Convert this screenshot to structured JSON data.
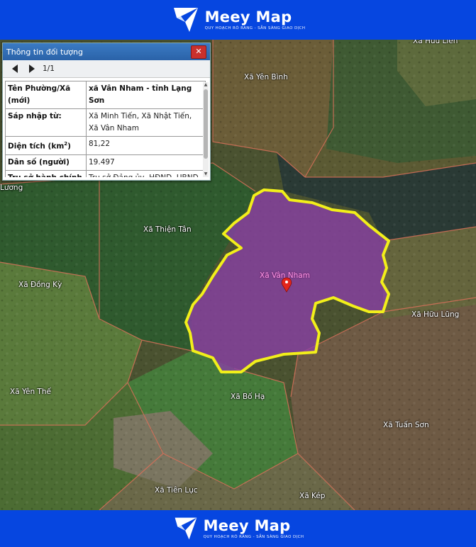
{
  "brand": {
    "name": "Meey Map",
    "tagline": "QUY HOẠCH RÕ RÀNG - SẴN SÀNG GIAO DỊCH"
  },
  "panel": {
    "title": "Thông tin đối tượng",
    "close": "✕",
    "page": "1/1",
    "rows": [
      {
        "key": "Tên Phường/Xã (mới)",
        "value": "xã Vân Nham - tỉnh Lạng Sơn"
      },
      {
        "key": "Sáp nhập từ:",
        "value": "Xã Minh Tiến, Xã Nhật Tiến, Xã Vân Nham"
      },
      {
        "key_main": "Diện tích (km",
        "key_sup": "2",
        "key_end": ")",
        "value": "81,22"
      },
      {
        "key": "Dân số (người)",
        "value": "19.497"
      },
      {
        "key": "Trụ sở hành chính (mới)",
        "value": "Trụ sở Đảng ủy, HĐND, UBND xã Minh Tiến"
      }
    ]
  },
  "map": {
    "highlight_label": "Xã Vân Nham",
    "highlight_fill": "#8b3fa8",
    "highlight_border": "#f2ef1a",
    "labels": {
      "yen_binh": "Xã Yên Bình",
      "huu_lien": "Xã Hữu Liên",
      "luong": "Lương",
      "thien_tan": "Xã Thiện Tân",
      "dong_ky": "Xã Đồng Kỳ",
      "huu_lung": "Xã Hữu Lũng",
      "yen_the": "Xã Yên Thế",
      "bo_ha": "Xã Bố Hạ",
      "tuan_son": "Xã Tuấn Sơn",
      "tien_luc": "Xã Tiên Lục",
      "kep": "Xã Kép"
    }
  }
}
